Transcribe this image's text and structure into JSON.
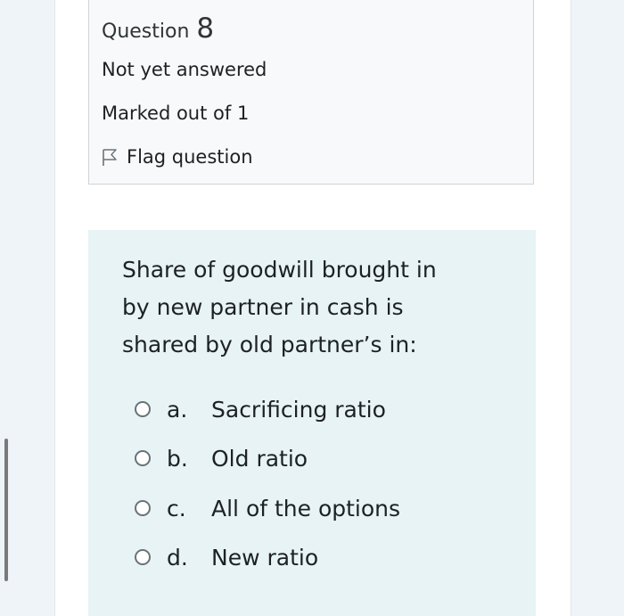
{
  "question_info": {
    "label": "Question",
    "number": "8",
    "state": "Not yet answered",
    "grade": "Marked out of 1",
    "flag_label": "Flag question"
  },
  "question": {
    "text_lines": [
      "Share of goodwill brought in",
      "by new partner in cash is",
      "shared by old partner’s in:"
    ],
    "answers": [
      {
        "letter": "a.",
        "text": "Sacrificing ratio"
      },
      {
        "letter": "b.",
        "text": "Old ratio"
      },
      {
        "letter": "c.",
        "text": "All of the options"
      },
      {
        "letter": "d.",
        "text": "New ratio"
      }
    ]
  }
}
